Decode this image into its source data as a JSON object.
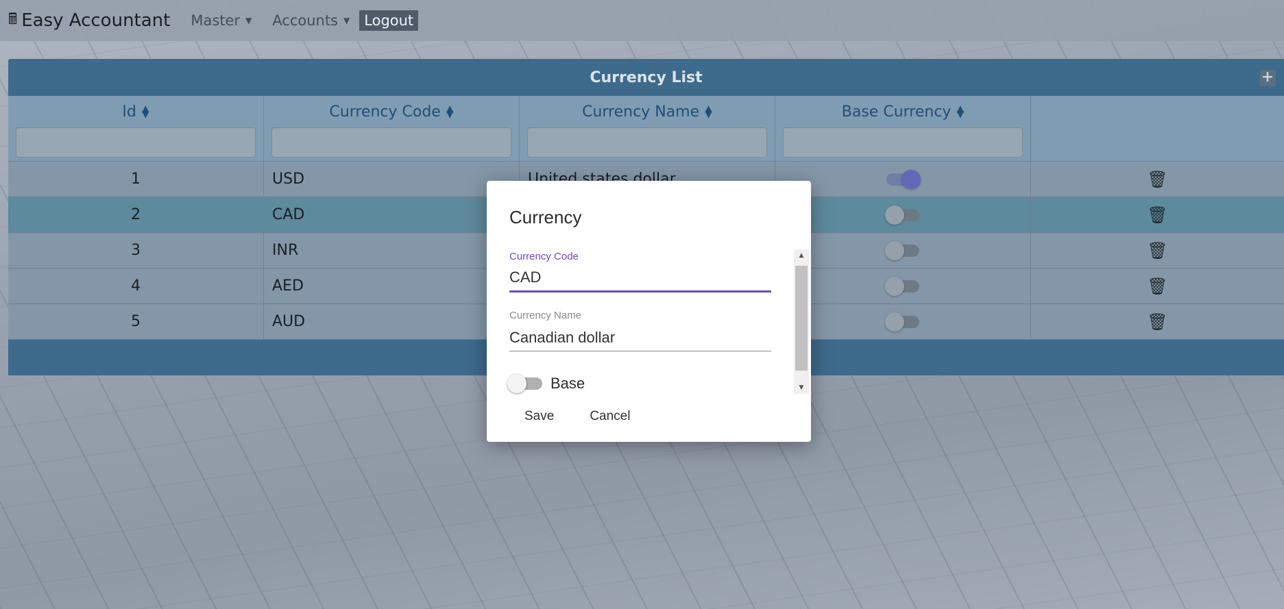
{
  "navbar": {
    "brand": "Easy Accountant",
    "menu": [
      {
        "label": "Master",
        "dropdown": true
      },
      {
        "label": "Accounts",
        "dropdown": true
      }
    ],
    "logout": "Logout"
  },
  "table": {
    "title": "Currency List",
    "columns": [
      "Id",
      "Currency Code",
      "Currency Name",
      "Base Currency"
    ],
    "rows": [
      {
        "id": "1",
        "code": "USD",
        "name": "United states dollar",
        "base": true,
        "selected": false
      },
      {
        "id": "2",
        "code": "CAD",
        "name": "",
        "base": false,
        "selected": true
      },
      {
        "id": "3",
        "code": "INR",
        "name": "",
        "base": false,
        "selected": false
      },
      {
        "id": "4",
        "code": "AED",
        "name": "",
        "base": false,
        "selected": false
      },
      {
        "id": "5",
        "code": "AUD",
        "name": "",
        "base": false,
        "selected": false
      }
    ]
  },
  "modal": {
    "title": "Currency",
    "code_label": "Currency Code",
    "code_value": "CAD",
    "name_label": "Currency Name",
    "name_value": "Canadian dollar",
    "base_label": "Base",
    "base_on": false,
    "save": "Save",
    "cancel": "Cancel"
  },
  "colors": {
    "accent": "#6f45c4",
    "header": "#3e6a8c",
    "toggle_on": "#6466b8"
  },
  "icons": {
    "trash": "trash-icon",
    "sort": "sort-icon",
    "add": "add-icon",
    "brand": "app-logo-icon"
  }
}
